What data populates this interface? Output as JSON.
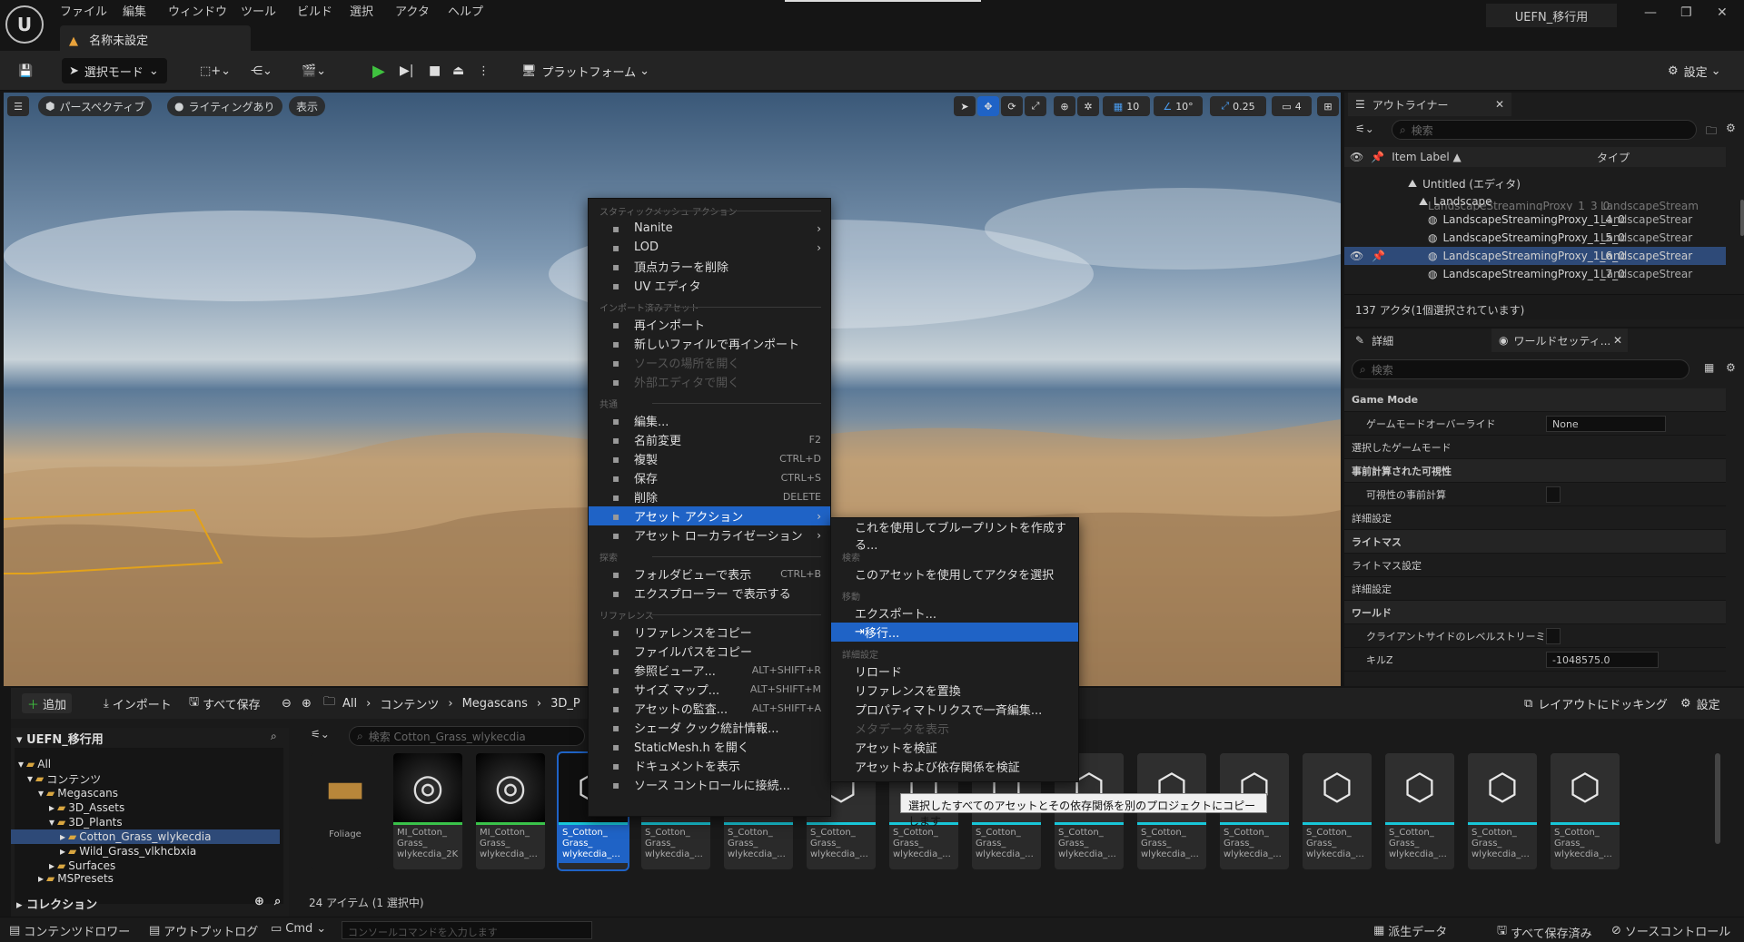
{
  "app": {
    "logo": "U",
    "project_title": "UEFN_移行用",
    "document_tab": "名称未設定",
    "warning_icon": "warning-icon"
  },
  "menubar": [
    "ファイル",
    "編集",
    "ウィンドウ",
    "ツール",
    "ビルド",
    "選択",
    "アクタ",
    "ヘルプ"
  ],
  "toolbar": {
    "select_mode": "選択モード",
    "platform": "プラットフォーム",
    "settings": "設定"
  },
  "viewport": {
    "perspective": "パースペクティブ",
    "lighting": "ライティングあり",
    "show": "表示",
    "grid_snap": "10",
    "rot_snap": "10°",
    "scale_snap": "0.25",
    "camera_speed": "4"
  },
  "outliner": {
    "tab": "アウトライナー",
    "search_placeholder": "検索",
    "col_label": "Item Label ▲",
    "col_type": "タイプ",
    "rows": [
      {
        "label": "Untitled (エディタ)",
        "type": ""
      },
      {
        "label": "Landscape",
        "type": ""
      },
      {
        "label": "LandscapeStreamingProxy_1_3_0",
        "type": "LandscapeStream"
      },
      {
        "label": "LandscapeStreamingProxy_1_4_0",
        "type": "LandscapeStrear"
      },
      {
        "label": "LandscapeStreamingProxy_1_5_0",
        "type": "LandscapeStrear"
      },
      {
        "label": "LandscapeStreamingProxy_1_6_0",
        "type": "LandscapeStrear"
      },
      {
        "label": "LandscapeStreamingProxy_1_7_0",
        "type": "LandscapeStrear"
      }
    ],
    "status": "137 アクタ(1個選択されています)"
  },
  "details": {
    "tab": "詳細",
    "tab2": "ワールドセッティ...",
    "search_placeholder": "検索",
    "rows": [
      {
        "label": "Game Mode",
        "head": true
      },
      {
        "label": "ゲームモードオーバーライド",
        "value": "None"
      },
      {
        "label": "選択したゲームモード",
        "sub": true
      },
      {
        "label": "事前計算された可視性",
        "head": true
      },
      {
        "label": "可視性の事前計算",
        "value": ""
      },
      {
        "label": "詳細設定",
        "sub": true
      },
      {
        "label": "ライトマス",
        "head": true
      },
      {
        "label": "ライトマス設定",
        "sub": true
      },
      {
        "label": "詳細設定",
        "sub": true
      },
      {
        "label": "ワールド",
        "head": true
      },
      {
        "label": "クライアントサイドのレベルストリーミ...",
        "value": ""
      },
      {
        "label": "キルZ",
        "value": "-1048575.0"
      }
    ]
  },
  "drawer": {
    "add": "追加",
    "import": "インポート",
    "save_all": "すべて保存",
    "breadcrumb": [
      "All",
      "コンテンツ",
      "Megascans",
      "3D_P"
    ],
    "dock": "レイアウトにドッキング",
    "settings": "設定",
    "tree_title": "UEFN_移行用",
    "tree": [
      "All",
      "コンテンツ",
      "Megascans",
      "3D_Assets",
      "3D_Plants",
      "Cotton_Grass_wlykecdia",
      "Wild_Grass_vlkhcbxia",
      "Surfaces",
      "MSPresets"
    ],
    "collections": "コレクション",
    "search_placeholder": "検索 Cotton_Grass_wlykecdia",
    "item_count": "24 アイテム (1 選択中)",
    "tiles": [
      {
        "label": "Foliage"
      },
      {
        "label": "MI_Cotton_ Grass_ wlykecdia_2K"
      },
      {
        "label": "MI_Cotton_ Grass_ wlykecdia_..."
      },
      {
        "label": "S_Cotton_ Grass_ wlykecdia_..."
      },
      {
        "label": "S_Cotton_ Grass_ wlykecdia_..."
      },
      {
        "label": "S_Cotton_ Grass_ wlykecdia_..."
      },
      {
        "label": "S_Cotton_ Grass_ wlykecdia_..."
      },
      {
        "label": "S_Cotton_ Grass_ wlykecdia_..."
      },
      {
        "label": "S_Cotton_ Grass_ wlykecdia_..."
      },
      {
        "label": "S_Cotton_ Grass_ wlykecdia_..."
      },
      {
        "label": "S_Cotton_ Grass_ wlykecdia_..."
      },
      {
        "label": "S_Cotton_ Grass_ wlykecdia_..."
      },
      {
        "label": "S_Cotton_ Grass_ wlykecdia_..."
      },
      {
        "label": "S_Cotton_ Grass_ wlykecdia_..."
      },
      {
        "label": "S_Cotton_ Grass_ wlykecdia_..."
      },
      {
        "label": "S_Cotton_ Grass_ wlykecdia_..."
      }
    ]
  },
  "context_menu": {
    "sections": [
      {
        "title": "スタティックメッシュ アクション",
        "items": [
          {
            "label": "Nanite",
            "arrow": true
          },
          {
            "label": "LOD",
            "arrow": true
          },
          {
            "label": "頂点カラーを削除"
          },
          {
            "label": "UV エディタ"
          }
        ]
      },
      {
        "title": "インポート済みアセット",
        "items": [
          {
            "label": "再インポート"
          },
          {
            "label": "新しいファイルで再インポート"
          },
          {
            "label": "ソースの場所を開く",
            "disabled": true
          },
          {
            "label": "外部エディタで開く",
            "disabled": true
          }
        ]
      },
      {
        "title": "共通",
        "items": [
          {
            "label": "編集..."
          },
          {
            "label": "名前変更",
            "shortcut": "F2"
          },
          {
            "label": "複製",
            "shortcut": "CTRL+D"
          },
          {
            "label": "保存",
            "shortcut": "CTRL+S"
          },
          {
            "label": "削除",
            "shortcut": "DELETE"
          },
          {
            "label": "アセット アクション",
            "arrow": true,
            "selected": true
          },
          {
            "label": "アセット ローカライゼーション",
            "arrow": true
          }
        ]
      },
      {
        "title": "探索",
        "items": [
          {
            "label": "フォルダビューで表示",
            "shortcut": "CTRL+B"
          },
          {
            "label": "エクスプローラー で表示する"
          }
        ]
      },
      {
        "title": "リファレンス",
        "items": [
          {
            "label": "リファレンスをコピー"
          },
          {
            "label": "ファイルパスをコピー"
          },
          {
            "label": "参照ビューア...",
            "shortcut": "ALT+SHIFT+R"
          },
          {
            "label": "サイズ マップ...",
            "shortcut": "ALT+SHIFT+M"
          },
          {
            "label": "アセットの監査...",
            "shortcut": "ALT+SHIFT+A"
          },
          {
            "label": "シェーダ クック統計情報..."
          },
          {
            "label": "StaticMesh.h を開く"
          },
          {
            "label": "ドキュメントを表示"
          },
          {
            "label": "ソース コントロールに接続..."
          }
        ]
      }
    ]
  },
  "submenu": {
    "items": [
      {
        "label": "これを使用してブループリントを作成する..."
      },
      {
        "section": "検索"
      },
      {
        "label": "このアセットを使用してアクタを選択"
      },
      {
        "section": "移動"
      },
      {
        "label": "エクスポート..."
      },
      {
        "label": "移行...",
        "selected": true
      },
      {
        "section": "詳細設定"
      },
      {
        "label": "リロード"
      },
      {
        "label": "リファレンスを置換"
      },
      {
        "label": "プロパティマトリクスで一斉編集..."
      },
      {
        "label": "メタデータを表示",
        "disabled": true
      },
      {
        "label": "アセットを検証"
      },
      {
        "label": "アセットおよび依存関係を検証"
      }
    ]
  },
  "tooltip": "選択したすべてのアセットとその依存関係を別のプロジェクトにコピーします",
  "statusbar": {
    "drawer": "コンテンツドロワー",
    "output": "アウトプットログ",
    "cmd": "Cmd",
    "console_placeholder": "コンソールコマンドを入力します",
    "derived": "派生データ",
    "all_saved": "すべて保存済み",
    "source_control": "ソースコントロール"
  }
}
